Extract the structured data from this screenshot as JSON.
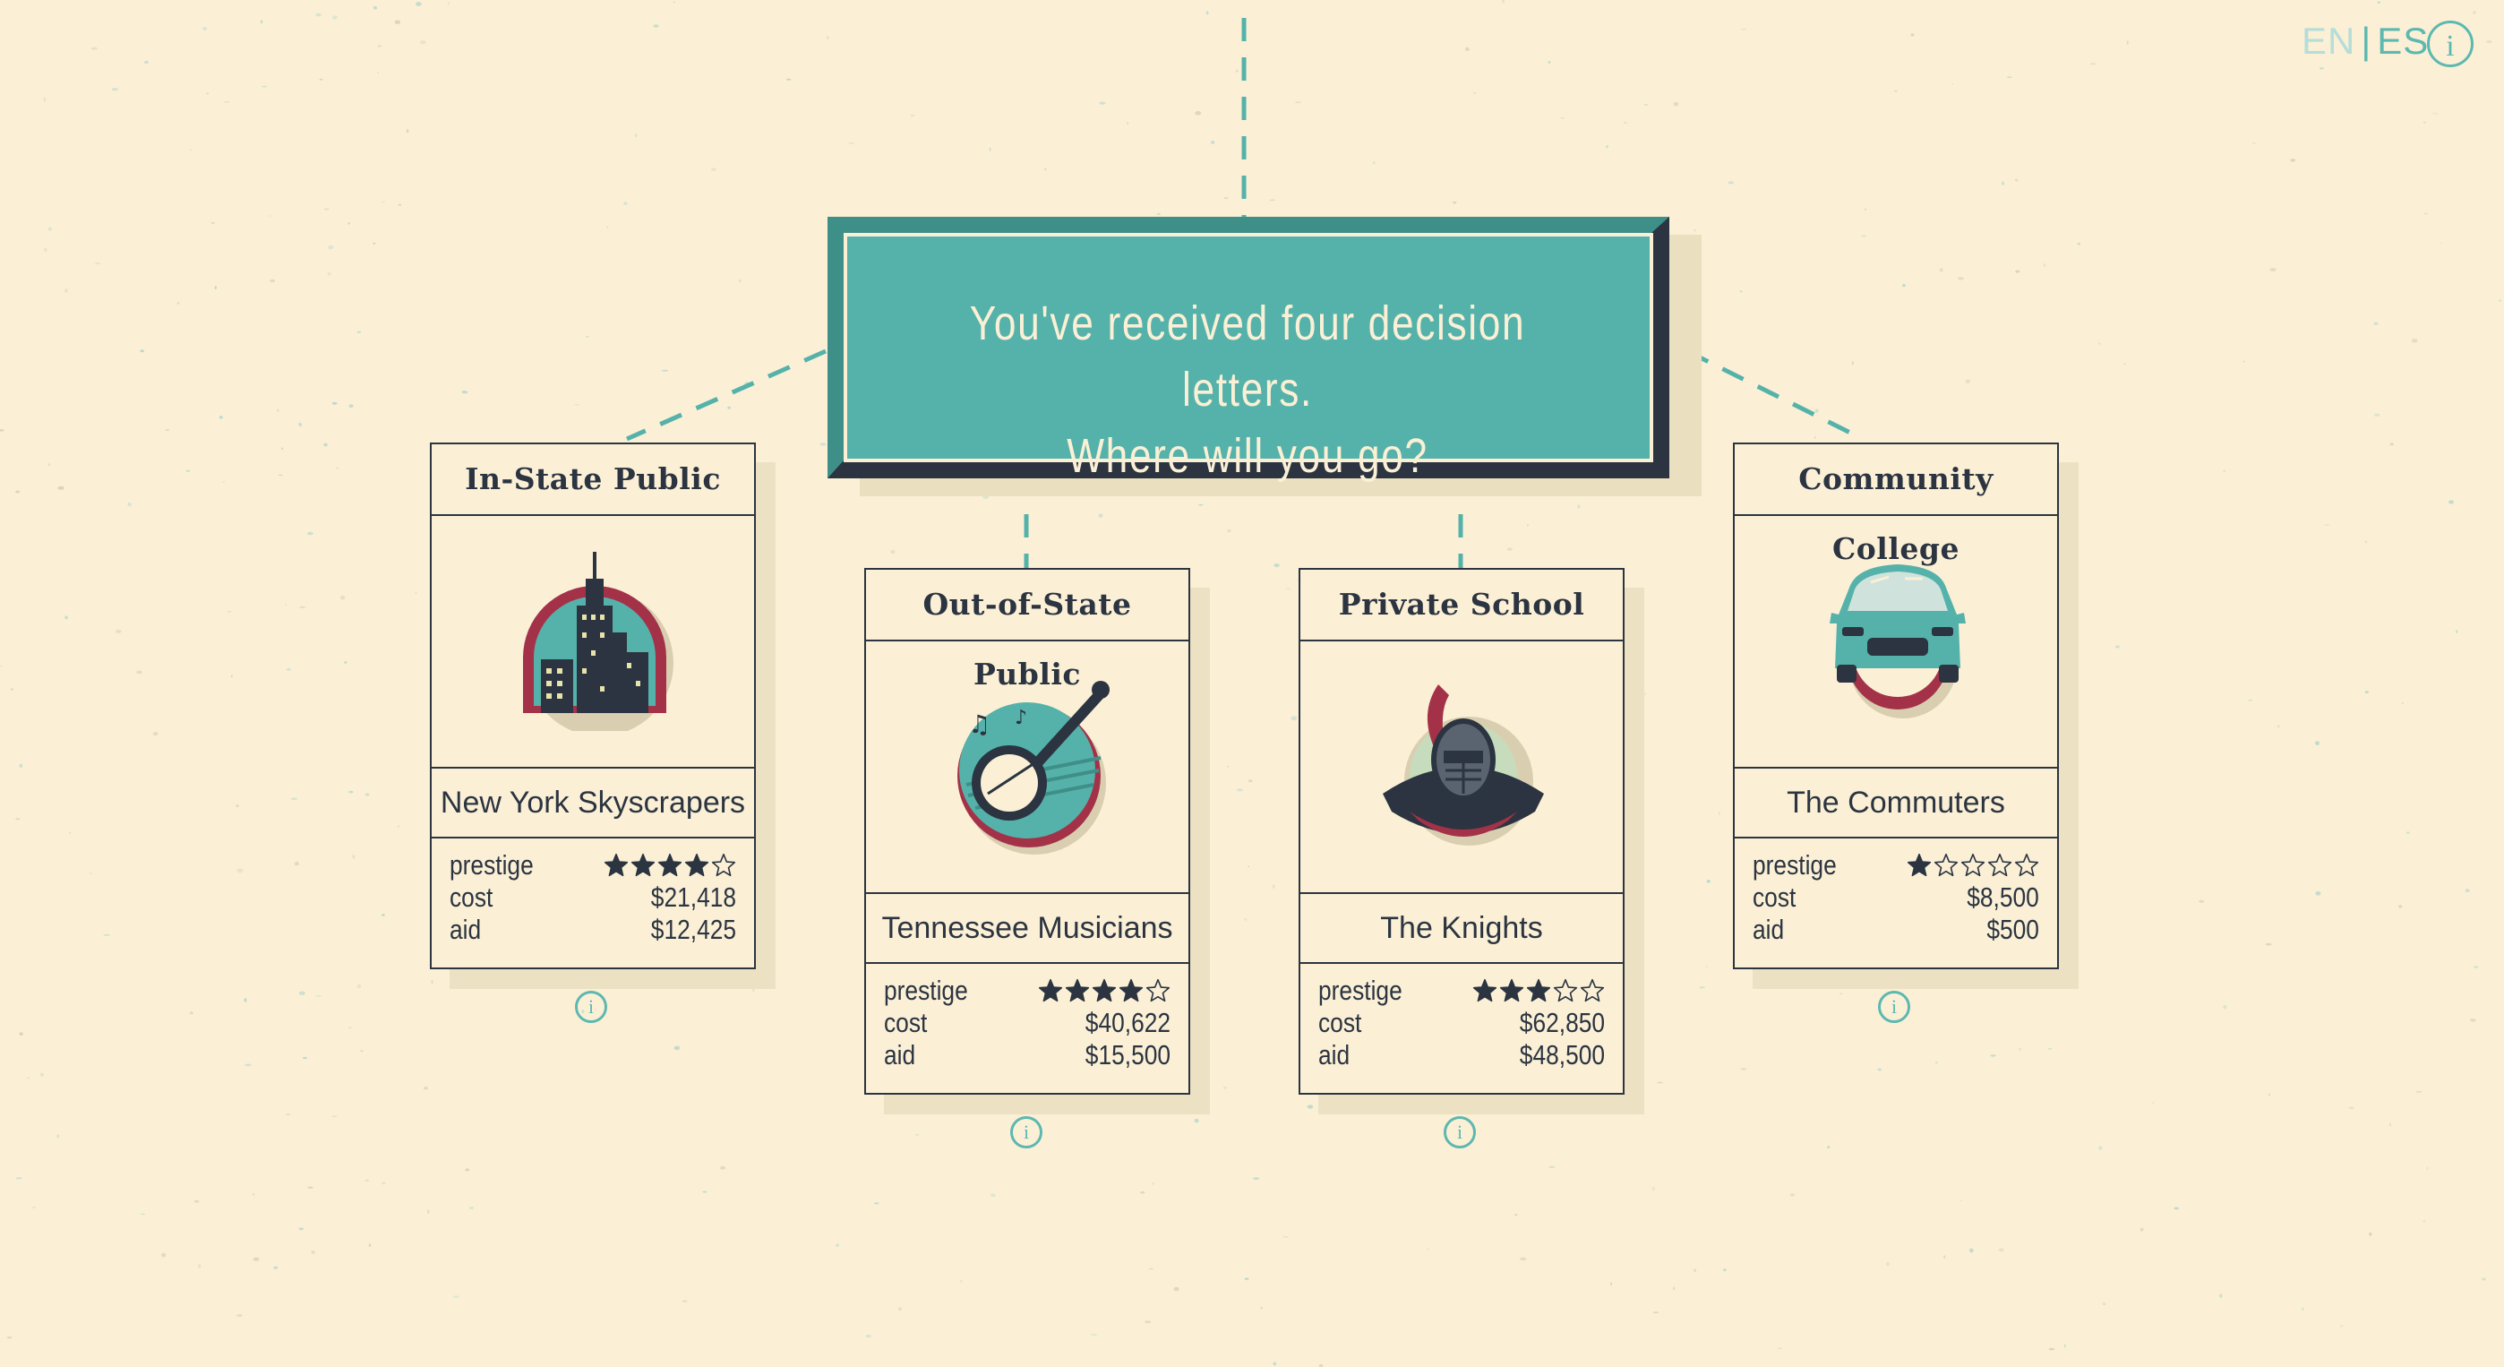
{
  "language": {
    "en": "EN",
    "separator": "|",
    "es": "ES"
  },
  "info_glyph": "i",
  "banner": {
    "line1": "You've received four decision letters.",
    "line2": "Where will you go?"
  },
  "colors": {
    "teal": "#55b2aa",
    "dark": "#2b3440",
    "cream": "#fbf0d6",
    "maroon": "#a33249"
  },
  "stat_labels": {
    "prestige": "prestige",
    "cost": "cost",
    "aid": "aid"
  },
  "cards": [
    {
      "title": "In-State Public",
      "icon": "skyscraper-icon",
      "name": "New York Skyscrapers",
      "prestige": 4,
      "cost": "$21,418",
      "aid": "$12,425"
    },
    {
      "title": "Out-of-State Public",
      "icon": "banjo-icon",
      "name": "Tennessee Musicians",
      "prestige": 4,
      "cost": "$40,622",
      "aid": "$15,500"
    },
    {
      "title": "Private School",
      "icon": "knight-icon",
      "name": "The Knights",
      "prestige": 3,
      "cost": "$62,850",
      "aid": "$48,500"
    },
    {
      "title": "Community College",
      "icon": "car-icon",
      "name": "The Commuters",
      "prestige": 1,
      "cost": "$8,500",
      "aid": "$500"
    }
  ]
}
